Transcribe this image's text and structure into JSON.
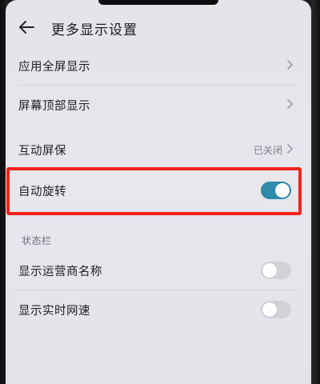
{
  "header": {
    "title": "更多显示设置",
    "back_icon": "back-arrow-icon"
  },
  "rows": {
    "full_screen": {
      "label": "应用全屏显示"
    },
    "top_display": {
      "label": "屏幕顶部显示"
    },
    "screensaver": {
      "label": "互动屏保",
      "status": "已关闭"
    },
    "auto_rotate": {
      "label": "自动旋转",
      "toggle": "on"
    }
  },
  "status_bar_section": {
    "title": "状态栏",
    "carrier_name": {
      "label": "显示运营商名称",
      "toggle": "off"
    },
    "network_speed": {
      "label": "显示实时网速",
      "toggle": "off"
    }
  },
  "colors": {
    "toggle_on": "#2f8ba9",
    "toggle_off": "#d1d1d8",
    "highlight": "#f1231b",
    "background": "#e5e5eb"
  }
}
